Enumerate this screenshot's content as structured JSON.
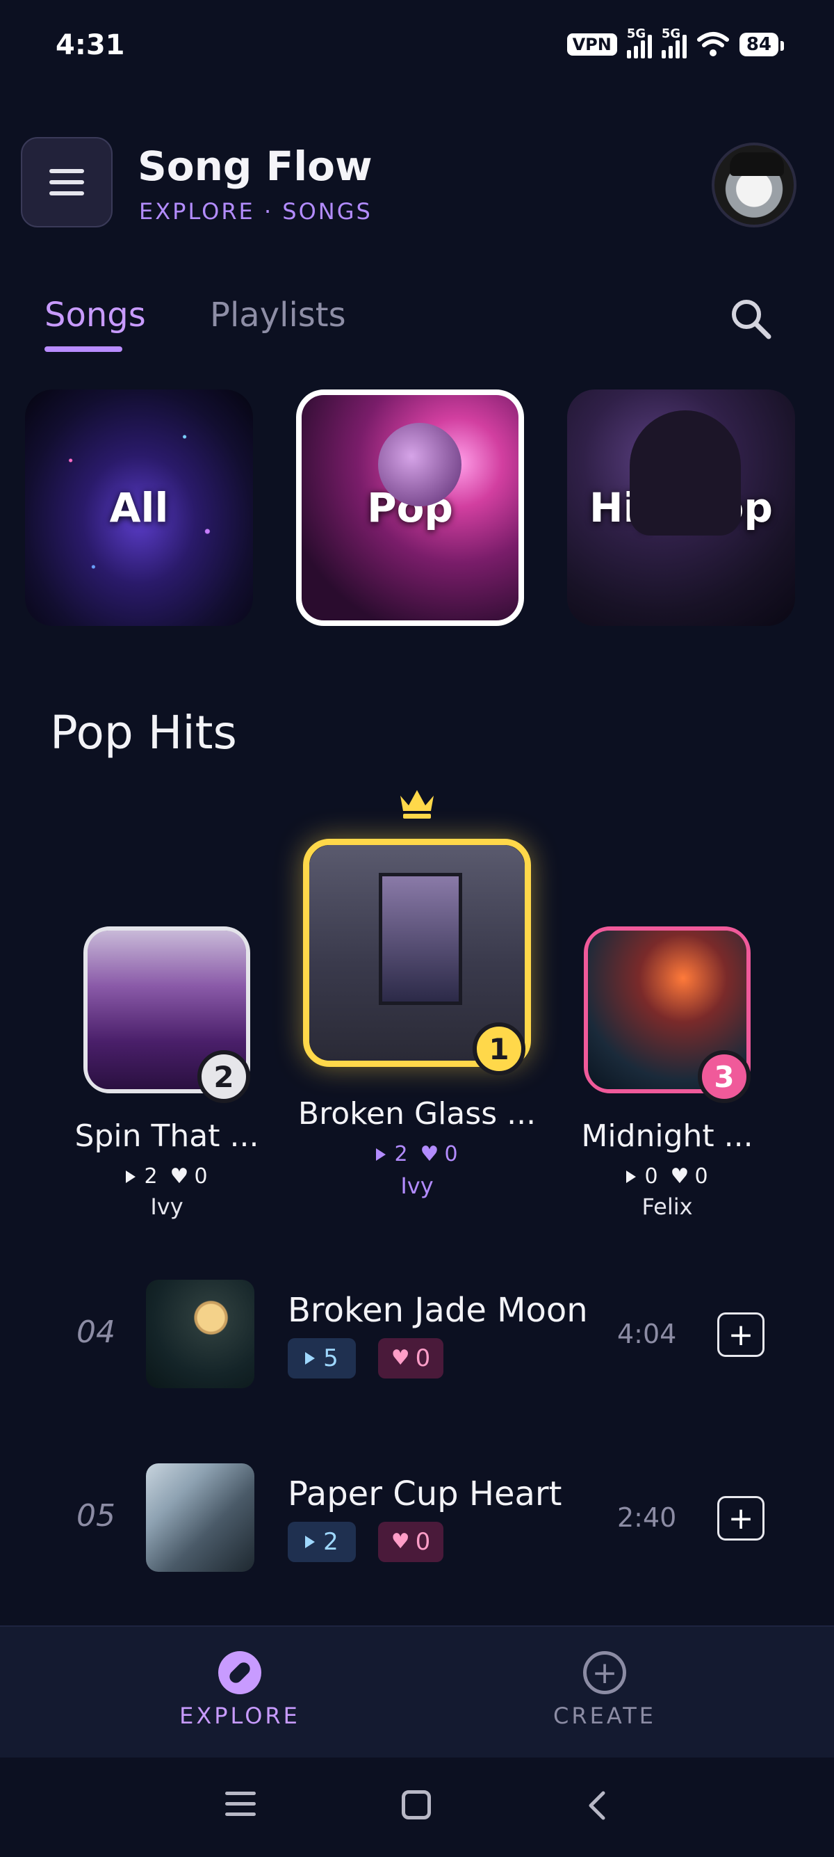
{
  "status_bar": {
    "time": "4:31",
    "vpn": "VPN",
    "signal_tag_1": "5G",
    "signal_tag_2": "5G",
    "battery": "84"
  },
  "header": {
    "app_title": "Song Flow",
    "breadcrumb": "EXPLORE · SONGS"
  },
  "tabs": [
    {
      "label": "Songs",
      "active": true
    },
    {
      "label": "Playlists",
      "active": false
    }
  ],
  "genres": [
    {
      "label": "All",
      "selected": false
    },
    {
      "label": "Pop",
      "selected": true
    },
    {
      "label": "Hip-Hop",
      "selected": false
    }
  ],
  "section": {
    "title": "Pop Hits"
  },
  "podium": [
    {
      "rank": "1",
      "title": "Broken Glass ...",
      "plays": "2",
      "likes": "0",
      "artist": "Ivy",
      "accent": "#ffd84a"
    },
    {
      "rank": "2",
      "title": "Spin That ...",
      "plays": "2",
      "likes": "0",
      "artist": "Ivy",
      "accent": "#e4e4ea"
    },
    {
      "rank": "3",
      "title": "Midnight ...",
      "plays": "0",
      "likes": "0",
      "artist": "Felix",
      "accent": "#f05a9a"
    }
  ],
  "list": [
    {
      "number": "04",
      "title": "Broken Jade Moon",
      "plays": "5",
      "likes": "0",
      "duration": "4:04"
    },
    {
      "number": "05",
      "title": "Paper Cup Heart",
      "plays": "2",
      "likes": "0",
      "duration": "2:40"
    }
  ],
  "bottom_nav": [
    {
      "label": "EXPLORE",
      "icon": "compass-icon",
      "active": true
    },
    {
      "label": "CREATE",
      "icon": "plus-circle-icon",
      "active": false
    }
  ],
  "colors": {
    "background": "#0c1021",
    "accent": "#b98cff",
    "gold": "#ffd84a",
    "pink": "#f05a9a"
  }
}
